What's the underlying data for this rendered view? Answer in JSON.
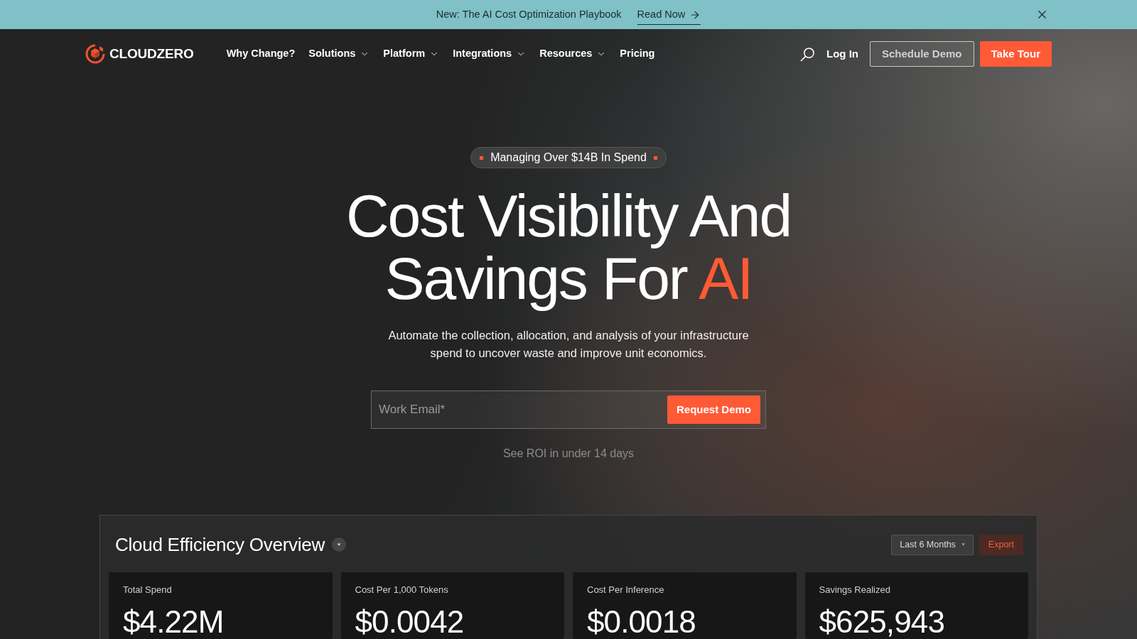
{
  "announcement": {
    "text": "New: The AI Cost Optimization Playbook",
    "link": "Read Now"
  },
  "nav": {
    "brand": "CLOUDZERO",
    "links": [
      {
        "label": "Why Change?",
        "dropdown": false
      },
      {
        "label": "Solutions",
        "dropdown": true
      },
      {
        "label": "Platform",
        "dropdown": true
      },
      {
        "label": "Integrations",
        "dropdown": true
      },
      {
        "label": "Resources",
        "dropdown": true
      },
      {
        "label": "Pricing",
        "dropdown": false
      }
    ],
    "login": "Log In",
    "buttons": [
      {
        "label": "Schedule Demo",
        "kind": "outline"
      },
      {
        "label": "Take Tour",
        "kind": "primary"
      }
    ]
  },
  "hero": {
    "badge": "Managing Over $14B In Spend",
    "title": [
      [
        {
          "text": "Cost Visibility And",
          "accent": false
        }
      ],
      [
        {
          "text": "Savings For",
          "accent": false
        },
        {
          "text": "AI",
          "accent": true
        }
      ]
    ],
    "subtitle": "Automate the collection, allocation, and analysis of your infrastructure spend to uncover waste and improve unit economics.",
    "email_field": {
      "placeholder": "Work Email*"
    },
    "submit": "Request Demo",
    "note": "See ROI in under 14 days"
  },
  "dashboard": {
    "title": "Cloud Efficiency Overview",
    "period": "Last 6 Months",
    "export": "Export",
    "metrics": [
      {
        "label": "Total Spend",
        "value": "$4.22M"
      },
      {
        "label": "Cost Per 1,000 Tokens",
        "value": "$0.0042"
      },
      {
        "label": "Cost Per Inference",
        "value": "$0.0018"
      },
      {
        "label": "Savings Realized",
        "value": "$625,943"
      }
    ]
  }
}
